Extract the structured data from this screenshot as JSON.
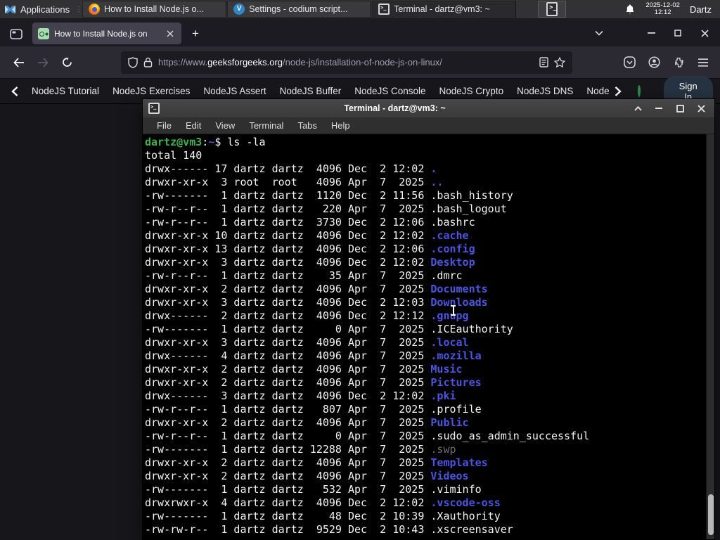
{
  "colors": {
    "prompt_green": "#3cb44a",
    "dir_blue": "#4a55e0",
    "gfg_green": "#2f8d46",
    "signin_bg": "#263342"
  },
  "panel": {
    "applications_label": "Applications",
    "taskbar": [
      {
        "icon": "firefox",
        "label": "How to Install Node.js o...",
        "active": false
      },
      {
        "icon": "codium",
        "label": "Settings - codium script...",
        "active": false
      },
      {
        "icon": "terminal",
        "label": "Terminal - dartz@vm3: ~",
        "active": true
      }
    ],
    "clock_date": "2025-12-02",
    "clock_time": "12:12",
    "user": "Dartz"
  },
  "browser": {
    "tab_title": "How to Install Node.js on",
    "url_prefix": "https://www.",
    "url_domain": "geeksforgeeks.org",
    "url_path": "/node-js/installation-of-node-js-on-linux/",
    "nav_items": [
      "NodeJS Tutorial",
      "NodeJS Exercises",
      "NodeJS Assert",
      "NodeJS Buffer",
      "NodeJS Console",
      "NodeJS Crypto",
      "NodeJS DNS",
      "Node"
    ],
    "sign_in_label": "Sign In"
  },
  "terminal": {
    "title": "Terminal - dartz@vm3: ~",
    "menu": [
      "File",
      "Edit",
      "View",
      "Terminal",
      "Tabs",
      "Help"
    ],
    "lines": [
      [
        {
          "t": "dartz@vm3",
          "c": "p"
        },
        {
          "t": ":",
          "c": "f"
        },
        {
          "t": "~",
          "c": "b"
        },
        {
          "t": "$ ls -la",
          "c": "f"
        }
      ],
      [
        {
          "t": "total 140",
          "c": "f"
        }
      ],
      [
        {
          "t": "drwx------ 17 dartz dartz  4096 Dec  2 12:02 ",
          "c": "f"
        },
        {
          "t": ".",
          "c": "d"
        }
      ],
      [
        {
          "t": "drwxr-xr-x  3 root  root   4096 Apr  7  2025 ",
          "c": "f"
        },
        {
          "t": "..",
          "c": "d"
        }
      ],
      [
        {
          "t": "-rw-------  1 dartz dartz  1120 Dec  2 11:56 .bash_history",
          "c": "f"
        }
      ],
      [
        {
          "t": "-rw-r--r--  1 dartz dartz   220 Apr  7  2025 .bash_logout",
          "c": "f"
        }
      ],
      [
        {
          "t": "-rw-r--r--  1 dartz dartz  3730 Dec  2 12:06 .bashrc",
          "c": "f"
        }
      ],
      [
        {
          "t": "drwxr-xr-x 10 dartz dartz  4096 Dec  2 12:02 ",
          "c": "f"
        },
        {
          "t": ".cache",
          "c": "d"
        }
      ],
      [
        {
          "t": "drwxr-xr-x 13 dartz dartz  4096 Dec  2 12:06 ",
          "c": "f"
        },
        {
          "t": ".config",
          "c": "d"
        }
      ],
      [
        {
          "t": "drwxr-xr-x  3 dartz dartz  4096 Dec  2 12:02 ",
          "c": "f"
        },
        {
          "t": "Desktop",
          "c": "d"
        }
      ],
      [
        {
          "t": "-rw-r--r--  1 dartz dartz    35 Apr  7  2025 .dmrc",
          "c": "f"
        }
      ],
      [
        {
          "t": "drwxr-xr-x  2 dartz dartz  4096 Apr  7  2025 ",
          "c": "f"
        },
        {
          "t": "Documents",
          "c": "d"
        }
      ],
      [
        {
          "t": "drwxr-xr-x  3 dartz dartz  4096 Dec  2 12:03 ",
          "c": "f"
        },
        {
          "t": "Downloads",
          "c": "d"
        }
      ],
      [
        {
          "t": "drwx------  2 dartz dartz  4096 Dec  2 12:12 ",
          "c": "f"
        },
        {
          "t": ".gnupg",
          "c": "d"
        }
      ],
      [
        {
          "t": "-rw-------  1 dartz dartz     0 Apr  7  2025 .ICEauthority",
          "c": "f"
        }
      ],
      [
        {
          "t": "drwxr-xr-x  3 dartz dartz  4096 Apr  7  2025 ",
          "c": "f"
        },
        {
          "t": ".local",
          "c": "d"
        }
      ],
      [
        {
          "t": "drwx------  4 dartz dartz  4096 Apr  7  2025 ",
          "c": "f"
        },
        {
          "t": ".mozilla",
          "c": "d"
        }
      ],
      [
        {
          "t": "drwxr-xr-x  2 dartz dartz  4096 Apr  7  2025 ",
          "c": "f"
        },
        {
          "t": "Music",
          "c": "d"
        }
      ],
      [
        {
          "t": "drwxr-xr-x  2 dartz dartz  4096 Apr  7  2025 ",
          "c": "f"
        },
        {
          "t": "Pictures",
          "c": "d"
        }
      ],
      [
        {
          "t": "drwx------  3 dartz dartz  4096 Dec  2 12:02 ",
          "c": "f"
        },
        {
          "t": ".pki",
          "c": "d"
        }
      ],
      [
        {
          "t": "-rw-r--r--  1 dartz dartz   807 Apr  7  2025 .profile",
          "c": "f"
        }
      ],
      [
        {
          "t": "drwxr-xr-x  2 dartz dartz  4096 Apr  7  2025 ",
          "c": "f"
        },
        {
          "t": "Public",
          "c": "d"
        }
      ],
      [
        {
          "t": "-rw-r--r--  1 dartz dartz     0 Apr  7  2025 .sudo_as_admin_successful",
          "c": "f"
        }
      ],
      [
        {
          "t": "-rw-------  1 dartz dartz 12288 Apr  7  2025 ",
          "c": "f"
        },
        {
          "t": ".swp",
          "c": "g"
        }
      ],
      [
        {
          "t": "drwxr-xr-x  2 dartz dartz  4096 Apr  7  2025 ",
          "c": "f"
        },
        {
          "t": "Templates",
          "c": "d"
        }
      ],
      [
        {
          "t": "drwxr-xr-x  2 dartz dartz  4096 Apr  7  2025 ",
          "c": "f"
        },
        {
          "t": "Videos",
          "c": "d"
        }
      ],
      [
        {
          "t": "-rw-------  1 dartz dartz   532 Apr  7  2025 .viminfo",
          "c": "f"
        }
      ],
      [
        {
          "t": "drwxrwxr-x  4 dartz dartz  4096 Dec  2 12:02 ",
          "c": "f"
        },
        {
          "t": ".vscode-oss",
          "c": "d"
        }
      ],
      [
        {
          "t": "-rw-------  1 dartz dartz    48 Dec  2 10:39 .Xauthority",
          "c": "f"
        }
      ],
      [
        {
          "t": "-rw-rw-r--  1 dartz dartz  9529 Dec  2 10:43 .xscreensaver",
          "c": "f"
        }
      ]
    ]
  }
}
